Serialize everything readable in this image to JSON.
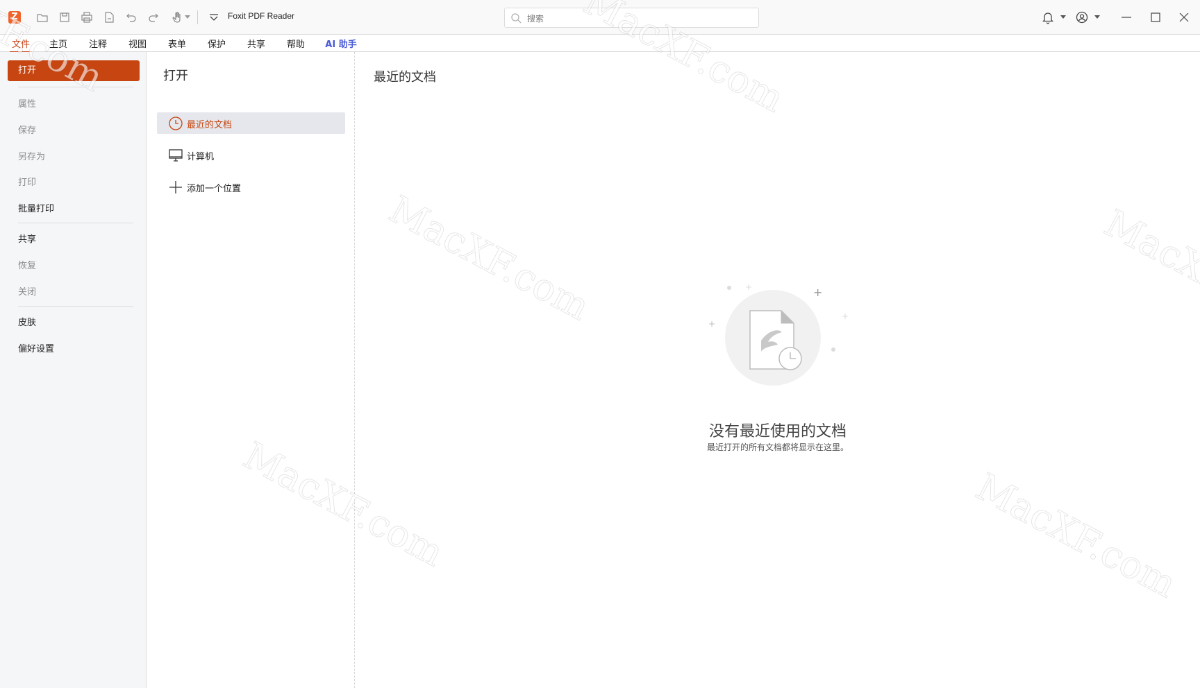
{
  "app": {
    "title": "Foxit PDF Reader",
    "logo_glyph": "Z",
    "accent_color": "#c74510",
    "ai_color": "#4b5bd6"
  },
  "quick_access": {
    "icons": [
      "open-icon",
      "save-icon",
      "print-icon",
      "new-document-icon",
      "undo-icon",
      "redo-icon",
      "hand-tool-icon"
    ]
  },
  "search": {
    "placeholder": "搜索",
    "value": ""
  },
  "window_controls": [
    "notification-bell-icon",
    "account-icon",
    "minimize-icon",
    "maximize-icon",
    "close-icon"
  ],
  "menu": {
    "tabs": [
      {
        "label": "文件",
        "active": true
      },
      {
        "label": "主页"
      },
      {
        "label": "注释"
      },
      {
        "label": "视图"
      },
      {
        "label": "表单"
      },
      {
        "label": "保护"
      },
      {
        "label": "共享"
      },
      {
        "label": "帮助"
      },
      {
        "label": "AI 助手"
      }
    ]
  },
  "file_nav": {
    "open": "打开",
    "items": [
      {
        "label": "属性",
        "enabled": false
      },
      {
        "label": "保存",
        "enabled": false
      },
      {
        "label": "另存为",
        "enabled": false
      },
      {
        "label": "打印",
        "enabled": false
      },
      {
        "label": "批量打印",
        "enabled": true
      },
      {
        "label": "共享",
        "enabled": true
      },
      {
        "label": "恢复",
        "enabled": false
      },
      {
        "label": "关闭",
        "enabled": false
      },
      {
        "label": "皮肤",
        "enabled": true
      },
      {
        "label": "偏好设置",
        "enabled": true
      }
    ]
  },
  "open_panel": {
    "title": "打开",
    "locations": [
      {
        "label": "最近的文档",
        "icon": "clock-icon",
        "active": true
      },
      {
        "label": "计算机",
        "icon": "monitor-icon"
      },
      {
        "label": "添加一个位置",
        "icon": "plus-icon"
      }
    ]
  },
  "recent": {
    "title": "最近的文档",
    "empty_title": "没有最近使用的文档",
    "empty_subtitle": "最近打开的所有文档都将显示在这里。"
  },
  "watermark": {
    "text": "MacXF.com"
  }
}
